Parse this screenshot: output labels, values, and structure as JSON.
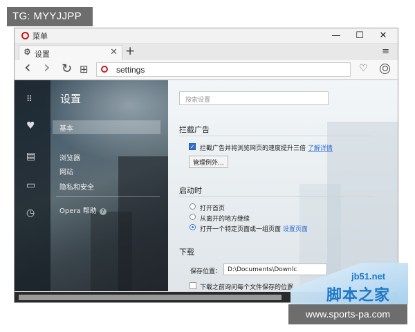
{
  "watermarks": {
    "top_left": "TG: MYYJJPP",
    "site_url": "jb51.net",
    "site_name": "脚本之家",
    "bottom_right": "www.sports-pa.com"
  },
  "window": {
    "menu_label": "菜单",
    "controls": {
      "minimize": "—",
      "maximize": "☐",
      "close": "✕"
    }
  },
  "tab": {
    "title": "设置",
    "close": "✕",
    "new_tab": "+",
    "tab_menu": "≡"
  },
  "toolbar": {
    "back": "‹",
    "forward": "›",
    "reload": "↻",
    "speed_dial": "⊞",
    "address": "settings",
    "heart": "♡"
  },
  "sidebar": {
    "title": "设置",
    "items": [
      {
        "label": "基本",
        "selected": true
      },
      {
        "label": "浏览器"
      },
      {
        "label": "网站"
      },
      {
        "label": "隐私和安全"
      }
    ],
    "help": "Opera 帮助"
  },
  "main": {
    "search_placeholder": "搜索设置",
    "adblock": {
      "heading": "拦截广告",
      "checkbox_label": "拦截广告并将浏览网页的速度提升三倍",
      "learn_more": "了解详情",
      "manage_exceptions": "管理例外..."
    },
    "startup": {
      "heading": "启动时",
      "options": [
        "打开首页",
        "从离开的地方继续",
        "打开一个特定页面或一组页面"
      ],
      "selected_index": 2,
      "set_pages_link": "设置页面"
    },
    "download": {
      "heading": "下载",
      "save_location_label": "保存位置：",
      "save_location_value": "D:\\Documents\\Downlc",
      "ask_label": "下载之前询问每个文件保存的位置"
    }
  }
}
